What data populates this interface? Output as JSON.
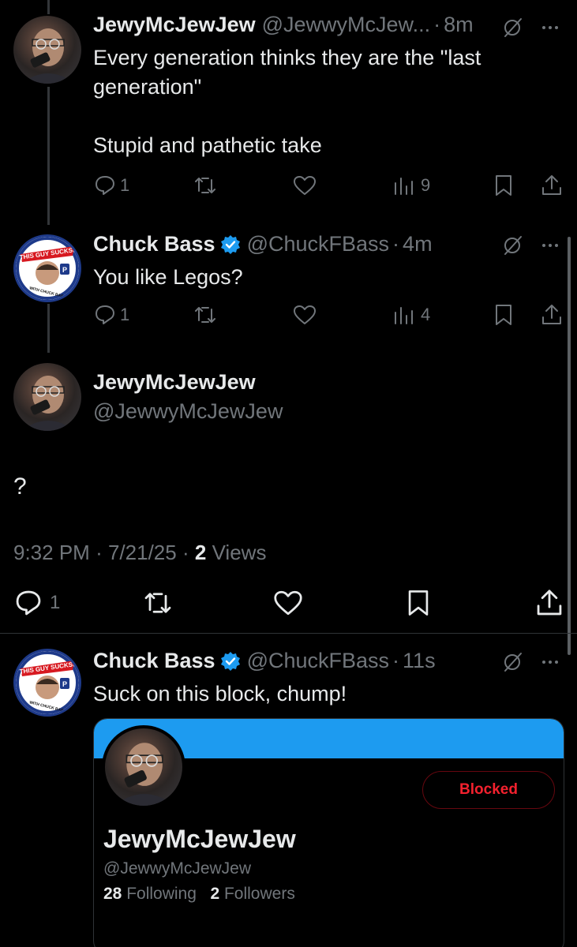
{
  "tweets": [
    {
      "name": "JewyMcJewJew",
      "handle": "@JewwyMcJew...",
      "time": "8m",
      "text_lines": [
        "Every generation thinks they are the \"last",
        "generation\"",
        "",
        "Stupid and pathetic take"
      ],
      "replies": "1",
      "views": "9",
      "avatar_icon": "man-on-phone-avatar"
    },
    {
      "name": "Chuck Bass",
      "handle": "@ChuckFBass",
      "time": "4m",
      "verified": true,
      "text": "You like Legos?",
      "replies": "1",
      "views": "4",
      "avatar_icon": "this-guy-sucks-badge-avatar",
      "avatar_text_top": "THIS GUY SUCKS!",
      "avatar_text_bottom": "WITH CHUCK BASS"
    }
  ],
  "focused": {
    "name": "JewyMcJewJew",
    "handle": "@JewwyMcJewJew",
    "text": "?",
    "time": "9:32 PM",
    "date": "7/21/25",
    "views_count": "2",
    "views_label": "Views",
    "replies": "1"
  },
  "reply": {
    "name": "Chuck Bass",
    "handle": "@ChuckFBass",
    "time": "11s",
    "text": "Suck on this block, chump!",
    "card": {
      "name": "JewyMcJewJew",
      "handle": "@JewwyMcJewJew",
      "following_count": "28",
      "following_label": "Following",
      "followers_count": "2",
      "followers_label": "Followers",
      "button_label": "Blocked"
    }
  },
  "separator_dot": "·",
  "colors": {
    "background": "#000000",
    "text": "#e7e9ea",
    "secondary": "#71767b",
    "verified": "#1d9bf0",
    "banner": "#1d9bf0",
    "blocked": "#f4212e"
  }
}
